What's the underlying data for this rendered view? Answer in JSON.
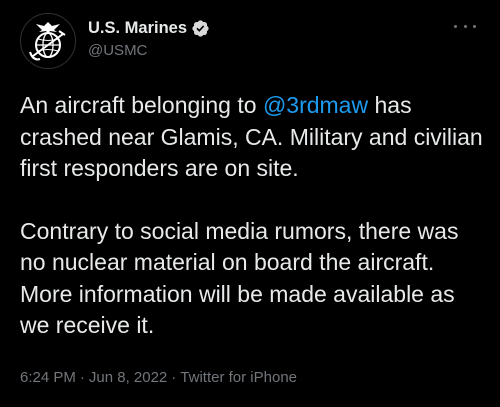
{
  "author": {
    "display_name": "U.S. Marines",
    "handle": "@USMC",
    "verified": true,
    "avatar_icon": "usmc-eagle-globe-anchor-emblem"
  },
  "tweet": {
    "paragraph1_before": "An aircraft belonging to ",
    "mention": "@3rdmaw",
    "paragraph1_after": " has crashed near Glamis, CA. Military and civilian first responders are on site.",
    "paragraph2": "Contrary to social media rumors, there was no nuclear material on board the aircraft. More information will be made available as we receive it."
  },
  "meta": {
    "time": "6:24 PM",
    "separator": "·",
    "date": "Jun 8, 2022",
    "source": "Twitter for iPhone"
  },
  "colors": {
    "background": "#000000",
    "text_primary": "#e7e9ea",
    "text_secondary": "#71767b",
    "link": "#1d9bf0",
    "verified_badge": "#d9d9d9"
  }
}
